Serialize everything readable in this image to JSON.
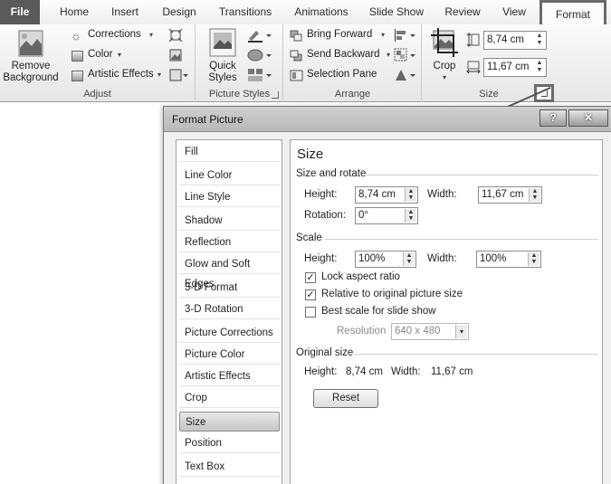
{
  "ribbon_tabs": [
    "File",
    "Home",
    "Insert",
    "Design",
    "Transitions",
    "Animations",
    "Slide Show",
    "Review",
    "View",
    "Format"
  ],
  "ribbon": {
    "remove_bg_line1": "Remove",
    "remove_bg_line2": "Background",
    "corrections": "Corrections",
    "color": "Color",
    "artistic_effects": "Artistic Effects",
    "adjust_label": "Adjust",
    "quick_styles_line1": "Quick",
    "quick_styles_line2": "Styles",
    "picture_styles_label": "Picture Styles",
    "bring_forward": "Bring Forward",
    "send_backward": "Send Backward",
    "selection_pane": "Selection Pane",
    "arrange_label": "Arrange",
    "crop": "Crop",
    "height_value": "8,74 cm",
    "width_value": "11,67 cm",
    "size_label": "Size",
    "caret": "▾"
  },
  "dialog": {
    "title": "Format Picture",
    "help": "?",
    "close": "✕",
    "nav_items": [
      "Fill",
      "Line Color",
      "Line Style",
      "Shadow",
      "Reflection",
      "Glow and Soft Edges",
      "3-D Format",
      "3-D Rotation",
      "Picture Corrections",
      "Picture Color",
      "Artistic Effects",
      "Crop",
      "Size",
      "Position",
      "Text Box"
    ],
    "selected_nav": "Size",
    "panel": {
      "heading": "Size",
      "size_rotate_label": "Size and rotate",
      "height_label": "Height:",
      "height_value": "8,74 cm",
      "width_label": "Width:",
      "width_value": "11,67 cm",
      "rotation_label": "Rotation:",
      "rotation_value": "0°",
      "scale_label": "Scale",
      "scale_height_label": "Height:",
      "scale_height_value": "100%",
      "scale_width_label": "Width:",
      "scale_width_value": "100%",
      "lock_aspect": "Lock aspect ratio",
      "lock_aspect_checked": true,
      "relative_original": "Relative to original picture size",
      "relative_original_checked": true,
      "best_scale": "Best scale for slide show",
      "best_scale_checked": false,
      "resolution_label": "Resolution",
      "resolution_value": "640 x 480",
      "original_size_label": "Original size",
      "orig_height_label": "Height:",
      "orig_height_value": "8,74 cm",
      "orig_width_label": "Width:",
      "orig_width_value": "11,67 cm",
      "reset_label": "Reset",
      "check_mark": "✓",
      "spin_up": "▲",
      "spin_down": "▼"
    }
  }
}
